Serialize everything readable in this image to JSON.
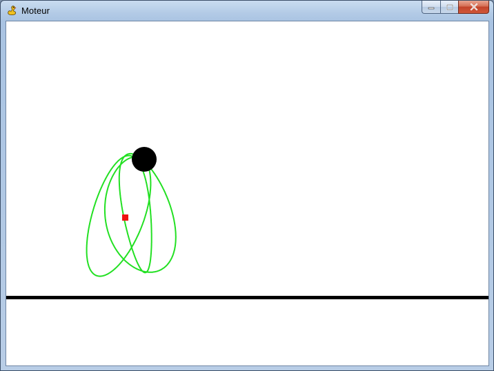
{
  "window": {
    "title": "Moteur",
    "app_icon": "pygame-snake-icon",
    "controls": {
      "minimize_icon": "minimize-icon",
      "maximize_icon": "maximize-icon",
      "close_icon": "close-icon"
    }
  },
  "colors": {
    "trajectory": "#22e022",
    "body": "#000000",
    "marker": "#ee1111",
    "ground": "#000000",
    "background": "#ffffff"
  }
}
